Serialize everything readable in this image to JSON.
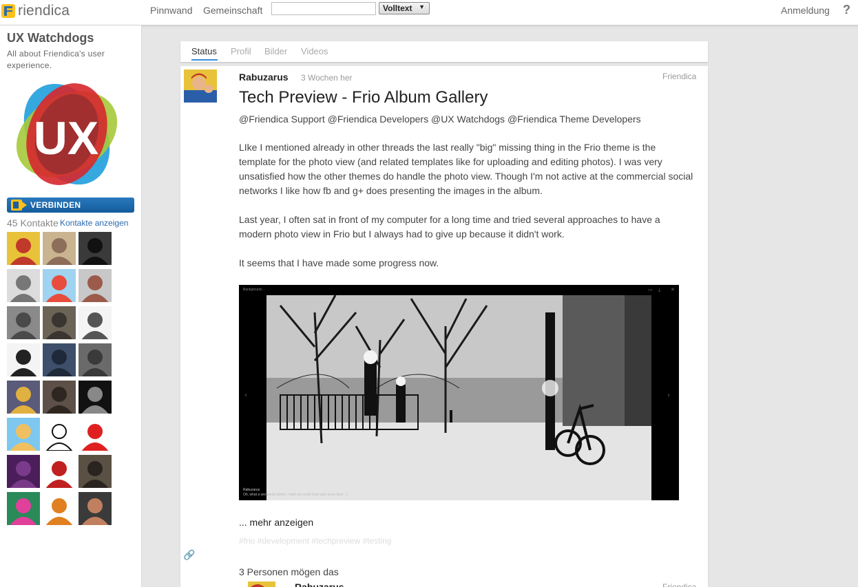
{
  "topbar": {
    "brand_name": "riendica",
    "nav": {
      "wall_label": "Pinnwand",
      "community_label": "Gemeinschaft"
    },
    "search": {
      "value": "",
      "placeholder": "",
      "type_selected": "Volltext"
    },
    "login_label": "Anmeldung",
    "help_label": "?"
  },
  "sidebar": {
    "group_name": "UX Watchdogs",
    "group_description": "All about Friendica's user experience.",
    "logo_text": "UX",
    "connect_label": "VERBINDEN",
    "contacts_count": "45 Kontakte",
    "contacts_link": "Kontakte anzeigen",
    "contacts": [
      {
        "bg": "#e8c33a",
        "fg": "#c0392b",
        "icon": "rosie-avatar"
      },
      {
        "bg": "#c9b48f",
        "fg": "#8d6e5a",
        "icon": "person-avatar"
      },
      {
        "bg": "#3a3a3a",
        "fg": "#111111",
        "icon": "person-avatar"
      },
      {
        "bg": "#dcdcdc",
        "fg": "#777777",
        "icon": "person-avatar"
      },
      {
        "bg": "#9fd3f0",
        "fg": "#e84c3d",
        "icon": "pony-avatar"
      },
      {
        "bg": "#c8c8c8",
        "fg": "#9c5a4a",
        "icon": "person-avatar"
      },
      {
        "bg": "#8a8a8a",
        "fg": "#4a4a4a",
        "icon": "person-avatar"
      },
      {
        "bg": "#6b6456",
        "fg": "#3a3530",
        "icon": "person-avatar"
      },
      {
        "bg": "#f4f4f4",
        "fg": "#555555",
        "icon": "sketch-avatar"
      },
      {
        "bg": "#f4f4f4",
        "fg": "#222222",
        "icon": "cartoon-avatar"
      },
      {
        "bg": "#3d4f6a",
        "fg": "#1e2a3a",
        "icon": "person-avatar"
      },
      {
        "bg": "#6a6a6a",
        "fg": "#3a3a3a",
        "icon": "person-avatar"
      },
      {
        "bg": "#5a5a7a",
        "fg": "#e0b040",
        "icon": "cartoon-avatar"
      },
      {
        "bg": "#5c5048",
        "fg": "#2e2620",
        "icon": "person-avatar"
      },
      {
        "bg": "#111111",
        "fg": "#888888",
        "icon": "person-avatar"
      },
      {
        "bg": "#7ec8f0",
        "fg": "#f0c060",
        "icon": "cartoon-avatar"
      },
      {
        "bg": "#ffffff",
        "fg": "#111111",
        "icon": "silhouette-avatar"
      },
      {
        "bg": "#ffffff",
        "fg": "#e02020",
        "icon": "cartoon-avatar"
      },
      {
        "bg": "#4a1e5a",
        "fg": "#7a3a8a",
        "icon": "abstract-avatar"
      },
      {
        "bg": "#ffffff",
        "fg": "#c02020",
        "icon": "pixel-avatar"
      },
      {
        "bg": "#5a5044",
        "fg": "#2a2420",
        "icon": "person-avatar"
      },
      {
        "bg": "#2a8a5a",
        "fg": "#e0409a",
        "icon": "rainbow-avatar"
      },
      {
        "bg": "#ffffff",
        "fg": "#e08020",
        "icon": "bird-avatar"
      },
      {
        "bg": "#3a3a3a",
        "fg": "#c08060",
        "icon": "person-avatar"
      }
    ]
  },
  "tabs": [
    {
      "label": "Status",
      "active": true
    },
    {
      "label": "Profil",
      "active": false
    },
    {
      "label": "Bilder",
      "active": false
    },
    {
      "label": "Videos",
      "active": false
    }
  ],
  "post": {
    "author": "Rabuzarus",
    "time": "3 Wochen her",
    "network": "Friendica",
    "title": "Tech Preview - Frio Album Gallery",
    "mentions": "@Friendica Support @Friendica Developers @UX Watchdogs @Friendica Theme Developers",
    "paragraphs": [
      "LIke I mentioned already in other threads the last really \"big\" missing thing in the Frio theme is the template for the photo view (and related templates like for uploading and editing photos). I was very unsatisfied how the other themes do handle the photo view. Though I'm not active at the commercial social networks I like how fb and g+ does presenting the images in the album.",
      "Last year, I often sat in front of my computer for a long time and tried several approaches to have a modern photo view in Frio but I always had to give up because it didn't work.",
      "It seems that I have made some progress now."
    ],
    "image": {
      "top_label": "Background...",
      "caption_author": "Rabuzarus",
      "caption_text": "Oh, what a wonderful winter. I wish we could have also snow here :-)"
    },
    "more_label": "... mehr anzeigen",
    "tags": "#frio #development #techpreview #testing",
    "likes": "3 Personen mögen das",
    "next_author": "Rabuzarus",
    "next_network": "Friendica"
  }
}
